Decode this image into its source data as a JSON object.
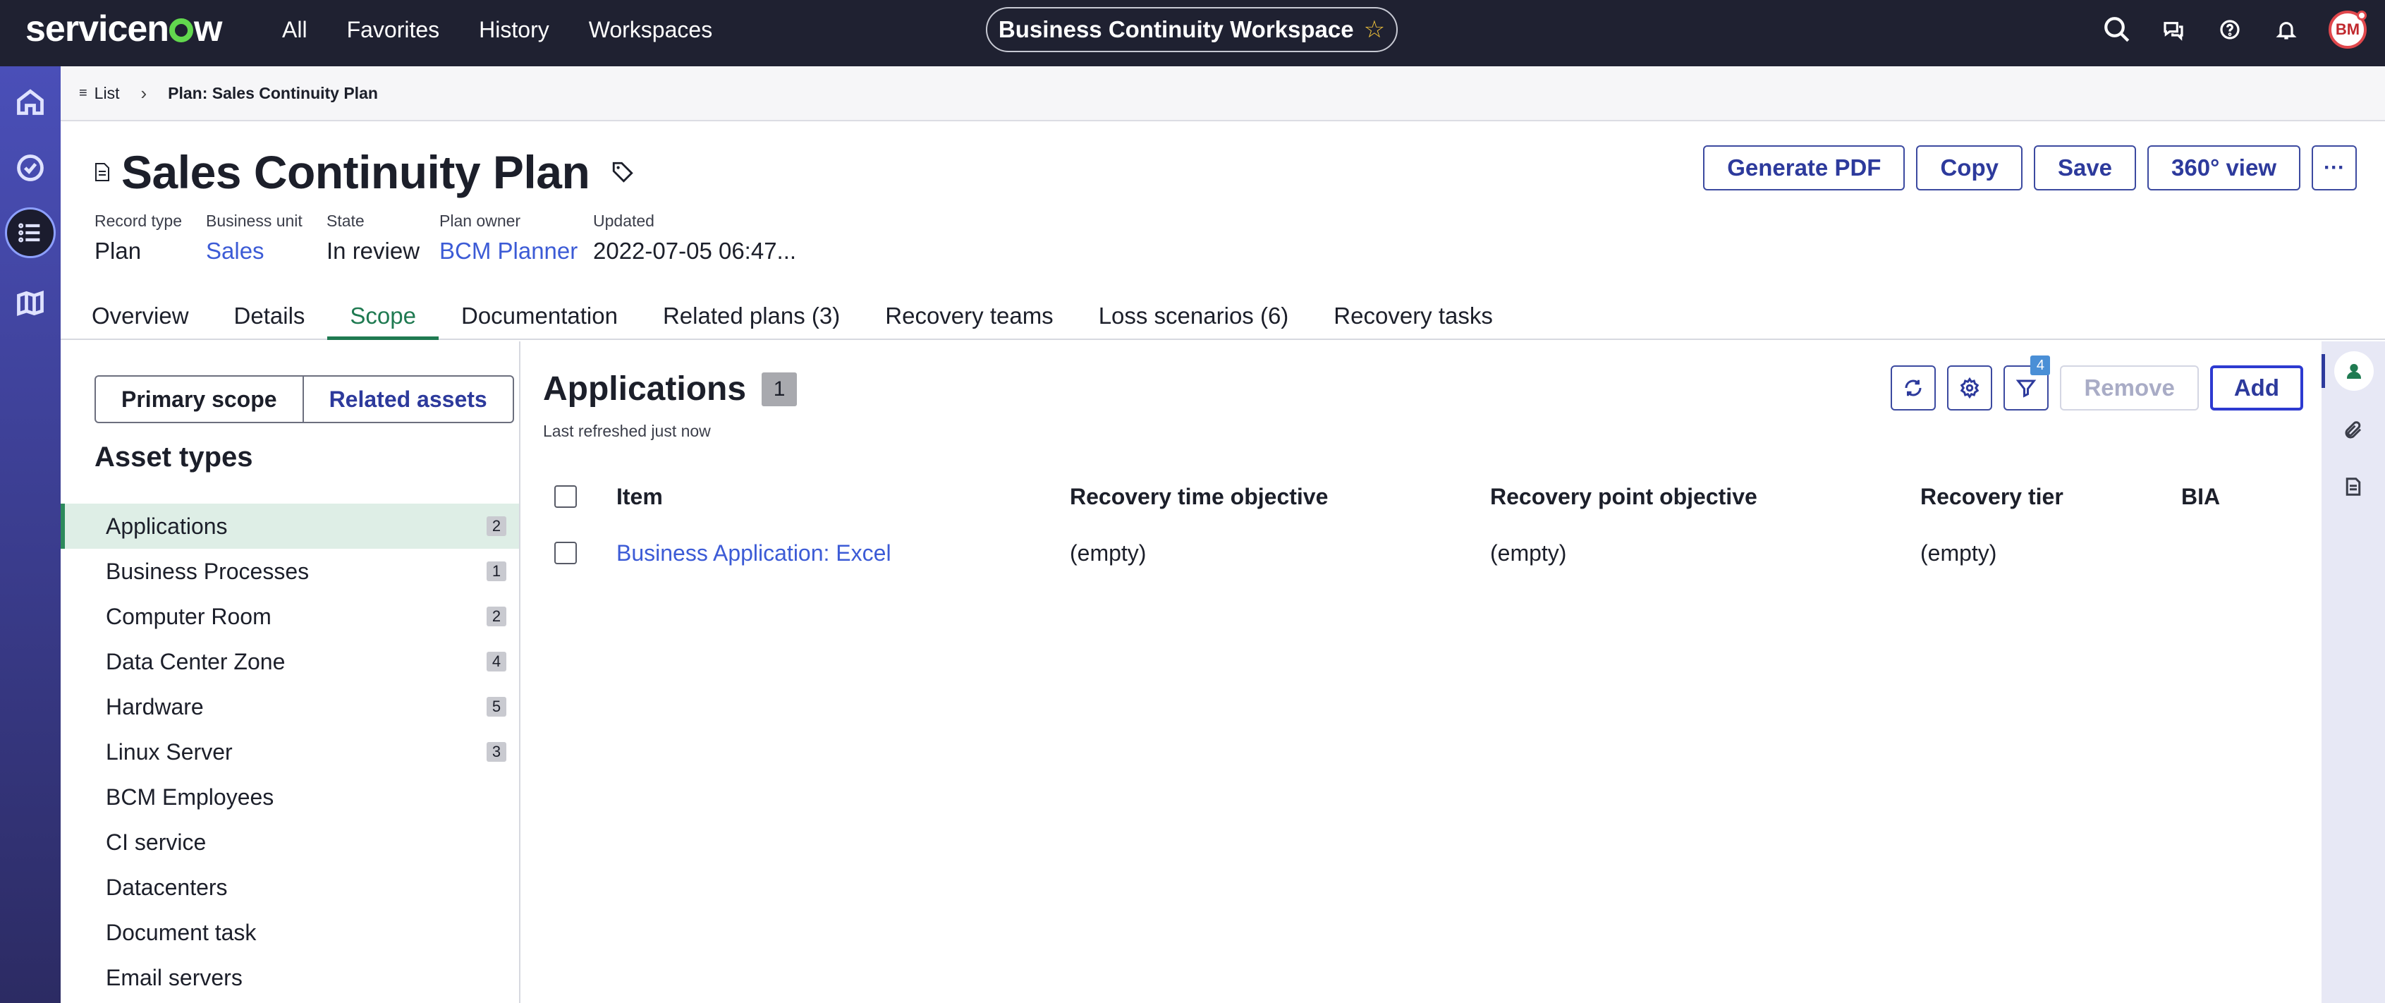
{
  "topbar": {
    "logo_text": "servicenow",
    "nav": [
      "All",
      "Favorites",
      "History",
      "Workspaces"
    ],
    "workspace_title": "Business Continuity Workspace",
    "avatar_initials": "BM",
    "icons": [
      "search-icon",
      "chat-icon",
      "help-icon",
      "bell-icon"
    ]
  },
  "leftrail": {
    "items": [
      "home-icon",
      "check-circle-icon",
      "list-icon",
      "map-icon"
    ],
    "active_index": 2
  },
  "breadcrumb": {
    "list_label": "List",
    "current": "Plan: Sales Continuity Plan"
  },
  "record": {
    "title": "Sales Continuity Plan",
    "fields": [
      {
        "label": "Record type",
        "value": "Plan",
        "link": false
      },
      {
        "label": "Business unit",
        "value": "Sales",
        "link": true
      },
      {
        "label": "State",
        "value": "In review",
        "link": false
      },
      {
        "label": "Plan owner",
        "value": "BCM Planner",
        "link": true
      },
      {
        "label": "Updated",
        "value": "2022-07-05 06:47...",
        "link": false
      }
    ],
    "actions": [
      "Generate PDF",
      "Copy",
      "Save",
      "360° view"
    ],
    "more_label": "···"
  },
  "tabs": {
    "items": [
      "Overview",
      "Details",
      "Scope",
      "Documentation",
      "Related plans (3)",
      "Recovery teams",
      "Loss scenarios (6)",
      "Recovery tasks"
    ],
    "active": "Scope"
  },
  "scope": {
    "segments": [
      "Primary scope",
      "Related assets"
    ],
    "heading": "Asset types",
    "assets": [
      {
        "name": "Applications",
        "count": "2"
      },
      {
        "name": "Business Processes",
        "count": "1"
      },
      {
        "name": "Computer Room",
        "count": "2"
      },
      {
        "name": "Data Center Zone",
        "count": "4"
      },
      {
        "name": "Hardware",
        "count": "5"
      },
      {
        "name": "Linux Server",
        "count": "3"
      },
      {
        "name": "BCM Employees",
        "count": ""
      },
      {
        "name": "CI service",
        "count": ""
      },
      {
        "name": "Datacenters",
        "count": ""
      },
      {
        "name": "Document task",
        "count": ""
      },
      {
        "name": "Email servers",
        "count": ""
      }
    ]
  },
  "main": {
    "title": "Applications",
    "count": "1",
    "refresh_note": "Last refreshed just now",
    "filter_count": "4",
    "remove_label": "Remove",
    "add_label": "Add",
    "columns": [
      "Item",
      "Recovery time objective",
      "Recovery point objective",
      "Recovery tier",
      "BIA"
    ],
    "rows": [
      {
        "item": "Business Application: Excel",
        "rto": "(empty)",
        "rpo": "(empty)",
        "tier": "(empty)",
        "bia": ""
      }
    ]
  },
  "sidepanel": {
    "items": [
      "user-icon",
      "paperclip-icon",
      "document-icon"
    ]
  },
  "colors": {
    "topbar": "#1f2131",
    "accent": "#2d3a9c",
    "active_tab": "#1f7a51",
    "link": "#3c5bd6"
  }
}
